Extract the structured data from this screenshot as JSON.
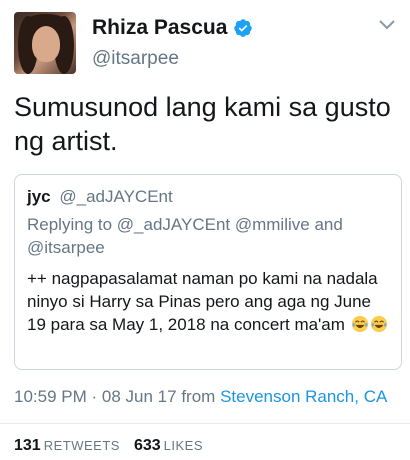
{
  "author": {
    "name": "Rhiza Pascua",
    "handle": "@itsarpee",
    "verified": true
  },
  "tweet": {
    "text": "Sumusunod lang kami sa gusto ng artist."
  },
  "quoted_tweet": {
    "name": "jyc",
    "handle": "@_adJAYCEnt",
    "replying_prefix": "Replying to",
    "replying_to": "@_adJAYCEnt @mmilive and @itsarpee",
    "text": "++ nagpapasalamat naman po kami na nadala ninyo si Harry sa Pinas pero ang aga ng June 19 para sa May 1, 2018 na concert ma'am",
    "emojis": [
      "face-with-tears-of-joy-icon",
      "face-with-tears-of-joy-icon"
    ]
  },
  "meta": {
    "time": "10:59 PM",
    "separator": "·",
    "date": "08 Jun 17",
    "from_label": "from",
    "location": "Stevenson Ranch, CA"
  },
  "stats": {
    "retweets_count": "131",
    "retweets_label": "RETWEETS",
    "likes_count": "633",
    "likes_label": "LIKES"
  },
  "colors": {
    "link": "#1b95e0",
    "secondary_text": "#657786",
    "verified_badge": "#1da1f2"
  }
}
